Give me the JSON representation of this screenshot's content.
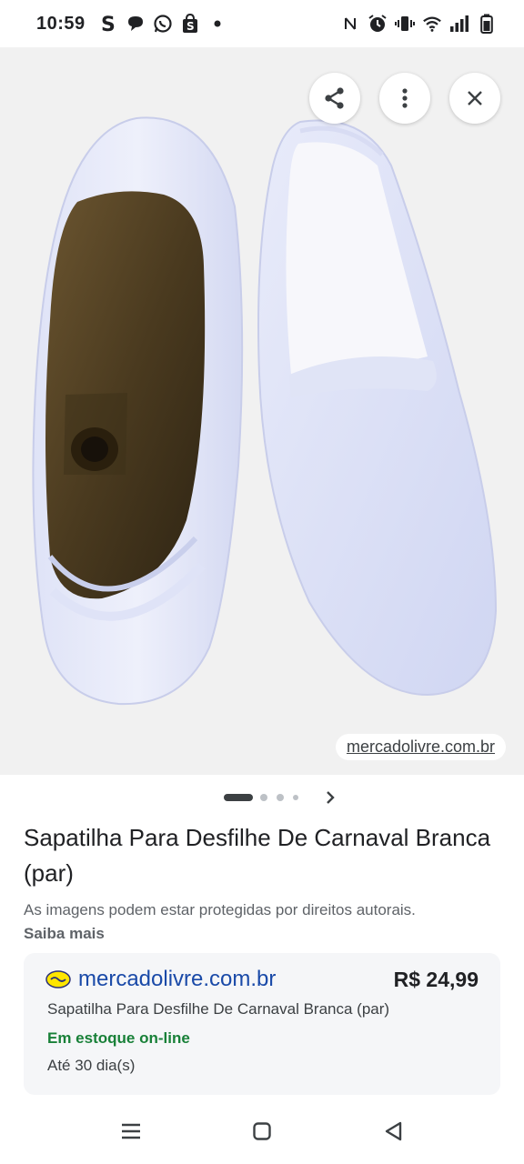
{
  "status_bar": {
    "time": "10:59",
    "left_icons": [
      "s-app-icon",
      "chat-icon",
      "whatsapp-icon",
      "shopping-bag-icon",
      "dot-icon"
    ],
    "right_icons": [
      "nfc-icon",
      "alarm-icon",
      "vibrate-icon",
      "wifi-icon",
      "signal-icon",
      "battery-icon"
    ]
  },
  "viewer": {
    "source_chip": "mercadolivre.com.br",
    "carousel_active_index": 0,
    "carousel_count": 4
  },
  "details": {
    "title": "Sapatilha Para Desfilhe De Carnaval Branca (par)",
    "copyright_notice": "As imagens podem estar protegidas por direitos autorais.",
    "learn_more": "Saiba mais"
  },
  "offer": {
    "domain": "mercadolivre.com.br",
    "price": "R$ 24,99",
    "product_name": "Sapatilha Para Desfilhe De Carnaval Branca (par)",
    "stock_status": "Em estoque on-line",
    "delivery": "Até 30 dia(s)",
    "stock_color": "#188038",
    "link_color": "#1a4aa8"
  }
}
